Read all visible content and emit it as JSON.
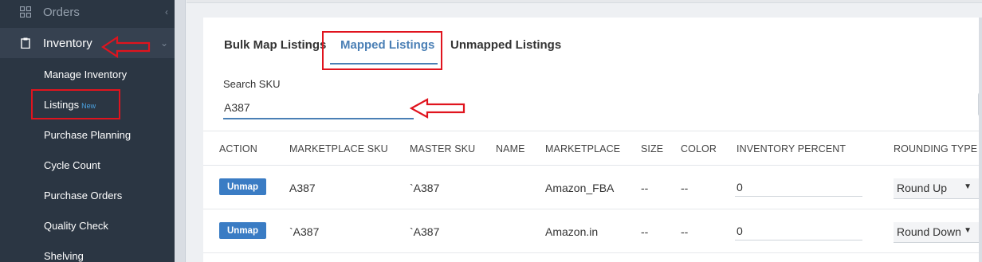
{
  "sidebar": {
    "orders_label": "Orders",
    "inventory_label": "Inventory",
    "sub_items": [
      {
        "label": "Manage Inventory"
      },
      {
        "label": "Listings",
        "badge": "New"
      },
      {
        "label": "Purchase Planning"
      },
      {
        "label": "Cycle Count"
      },
      {
        "label": "Purchase Orders"
      },
      {
        "label": "Quality Check"
      },
      {
        "label": "Shelving"
      }
    ]
  },
  "tabs": {
    "bulk": "Bulk Map Listings",
    "mapped": "Mapped Listings",
    "unmapped": "Unmapped Listings"
  },
  "search": {
    "label": "Search SKU",
    "value": "A387"
  },
  "table": {
    "headers": {
      "action": "ACTION",
      "marketplace_sku": "MARKETPLACE SKU",
      "master_sku": "MASTER SKU",
      "name": "NAME",
      "marketplace": "MARKETPLACE",
      "size": "SIZE",
      "color": "COLOR",
      "inventory_percent": "INVENTORY PERCENT",
      "rounding_type": "ROUNDING TYPE"
    },
    "rows": [
      {
        "action": "Unmap",
        "marketplace_sku": "A387",
        "master_sku": "`A387",
        "name": "",
        "marketplace": "Amazon_FBA",
        "size": "--",
        "color": "--",
        "inventory_percent": "0",
        "rounding_type": "Round Up"
      },
      {
        "action": "Unmap",
        "marketplace_sku": "`A387",
        "master_sku": "`A387",
        "name": "",
        "marketplace": "Amazon.in",
        "size": "--",
        "color": "--",
        "inventory_percent": "0",
        "rounding_type": "Round Down"
      }
    ]
  },
  "colors": {
    "sidebar_bg": "#2b3643",
    "accent": "#4a7fb5",
    "button": "#3a7cc4",
    "annotation": "#e0141e"
  }
}
